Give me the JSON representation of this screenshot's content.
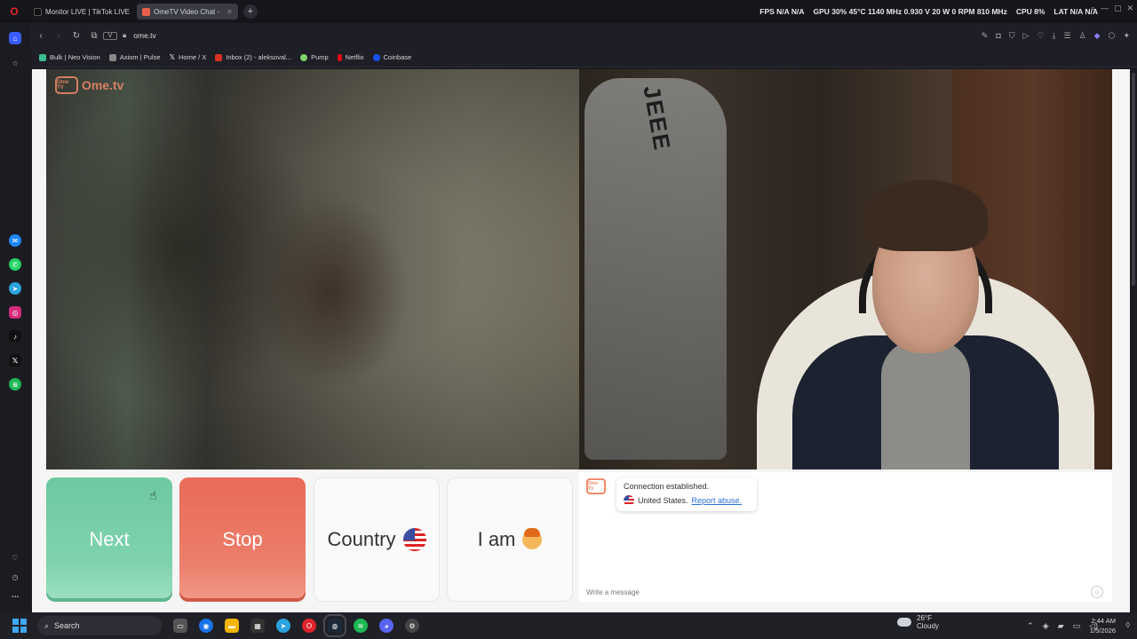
{
  "tabs": [
    {
      "label": "Monitor LIVE | TikTok LIVE",
      "color": "#111111"
    },
    {
      "label": "OmeTV Video Chat -",
      "color": "#e8604a"
    }
  ],
  "stats": {
    "fps": "FPS  N/A  N/A",
    "gpu": "GPU  30%  45°C  1140 MHz  0.930 V  20 W  0 RPM  810 MHz",
    "cpu": "CPU  8%",
    "lat": "LAT  N/A  N/A"
  },
  "address": {
    "url": "ome.tv",
    "vbadge": "V"
  },
  "bookmarks": [
    {
      "label": "Bulk | Neo Vision",
      "color": "#3bbf8f"
    },
    {
      "label": "Axiom | Pulse",
      "color": "#888888"
    },
    {
      "label": "Home / X",
      "color": "#ffffff"
    },
    {
      "label": "Inbox (2) - aleksoval...",
      "color": "#d93025"
    },
    {
      "label": "Pump",
      "color": "#7ed36a"
    },
    {
      "label": "Netflix",
      "color": "#e50914"
    },
    {
      "label": "Coinbase",
      "color": "#1652f0"
    }
  ],
  "logo": {
    "badge": "Ome TV",
    "text": "Ome.tv"
  },
  "remote_video": {
    "letters": "JEEE"
  },
  "buttons": {
    "next": "Next",
    "stop": "Stop",
    "country": "Country",
    "iam": "I am"
  },
  "chat": {
    "avatar": "Ome TV",
    "status": "Connection established.",
    "country": "United States.",
    "report": "Report abuse.",
    "placeholder": "Write a message"
  },
  "taskbar": {
    "search": "Search",
    "weather_temp": "26°F",
    "weather_desc": "Cloudy",
    "time": "2:44 AM",
    "date": "1/5/2026"
  }
}
